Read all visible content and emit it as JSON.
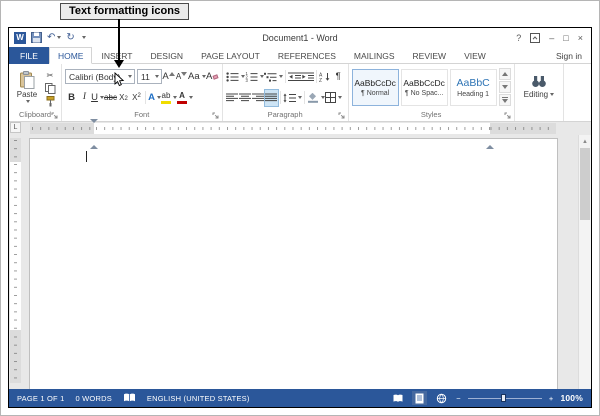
{
  "callout": {
    "label": "Text formatting icons"
  },
  "titlebar": {
    "title": "Document1 - Word"
  },
  "tabs": [
    "FILE",
    "HOME",
    "INSERT",
    "DESIGN",
    "PAGE LAYOUT",
    "REFERENCES",
    "MAILINGS",
    "REVIEW",
    "VIEW"
  ],
  "sign_in": "Sign in",
  "ribbon": {
    "clipboard": {
      "label": "Clipboard",
      "paste": "Paste"
    },
    "font": {
      "label": "Font",
      "name": "Calibri (Body)",
      "size": "11",
      "bold": "B",
      "italic": "I",
      "underline": "U",
      "strike": "abc",
      "subscript": "X",
      "subscript_small": "2",
      "superscript": "X",
      "superscript_small": "2",
      "grow": "A",
      "shrink": "A",
      "change_case": "Aa",
      "clear": "A",
      "effects": "A",
      "highlight": "ab",
      "color": "A"
    },
    "paragraph": {
      "label": "Paragraph"
    },
    "styles": {
      "label": "Styles",
      "items": [
        {
          "preview": "AaBbCcDc",
          "name": "¶ Normal"
        },
        {
          "preview": "AaBbCcDc",
          "name": "¶ No Spac..."
        },
        {
          "preview": "AaBbC",
          "name": "Heading 1"
        }
      ]
    },
    "editing": {
      "label": "Editing"
    }
  },
  "icons": {
    "logo": "W",
    "undo": "↶",
    "redo": "↻",
    "help": "?",
    "minimize": "–",
    "maximize": "□",
    "close": "×",
    "cut": "✂",
    "pilcrow": "¶",
    "tab_selector": "L",
    "scroll_up": "▲",
    "zoom_out": "−",
    "zoom_in": "+"
  },
  "statusbar": {
    "page": "PAGE 1 OF 1",
    "words": "0 WORDS",
    "language": "ENGLISH (UNITED STATES)",
    "zoom": "100%"
  },
  "colors": {
    "accent_blue": "#2b579a",
    "heading_style_blue": "#2e74b5",
    "highlight_yellow": "#f0dc00",
    "font_color_red": "#c00000"
  }
}
